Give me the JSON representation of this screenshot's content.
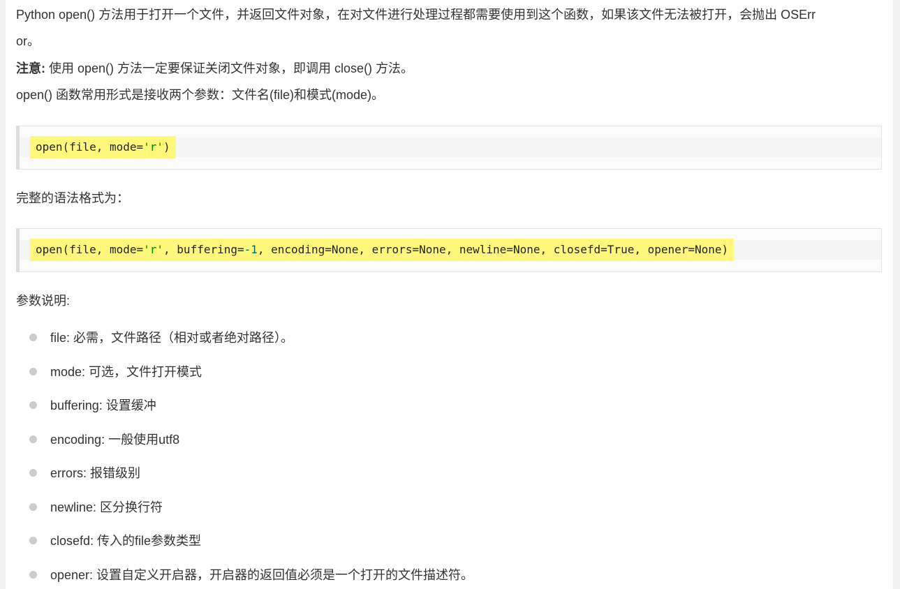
{
  "intro": {
    "line1": "Python open() 方法用于打开一个文件，并返回文件对象，在对文件进行处理过程都需要使用到这个函数，如果该文件无法被打开，会抛出 OSErr",
    "line2": "or。"
  },
  "note": {
    "label": "注意:",
    "text": "使用 open() 方法一定要保证关闭文件对象，即调用 close() 方法。"
  },
  "common_form_text": "open() 函数常用形式是接收两个参数：文件名(file)和模式(mode)。",
  "code_short": {
    "parts": [
      "open(file, mode=",
      "'r'",
      ")"
    ]
  },
  "full_syntax_label": "完整的语法格式为：",
  "code_full": {
    "parts": [
      "open(file, mode=",
      "'r'",
      ", buffering=",
      "-1",
      ", encoding=None, errors=None, newline=None, closefd=True, opener=None)"
    ]
  },
  "params_label": "参数说明:",
  "params": [
    "file: 必需，文件路径（相对或者绝对路径）。",
    "mode: 可选，文件打开模式",
    "buffering: 设置缓冲",
    "encoding: 一般使用utf8",
    "errors: 报错级别",
    "newline: 区分换行符",
    "closefd: 传入的file参数类型",
    "opener: 设置自定义开启器，开启器的返回值必须是一个打开的文件描述符。"
  ],
  "colors": {
    "highlight": "#fff87a",
    "string": "#008800",
    "number": "#006666",
    "text": "#333333",
    "bullet": "#cccccc"
  }
}
